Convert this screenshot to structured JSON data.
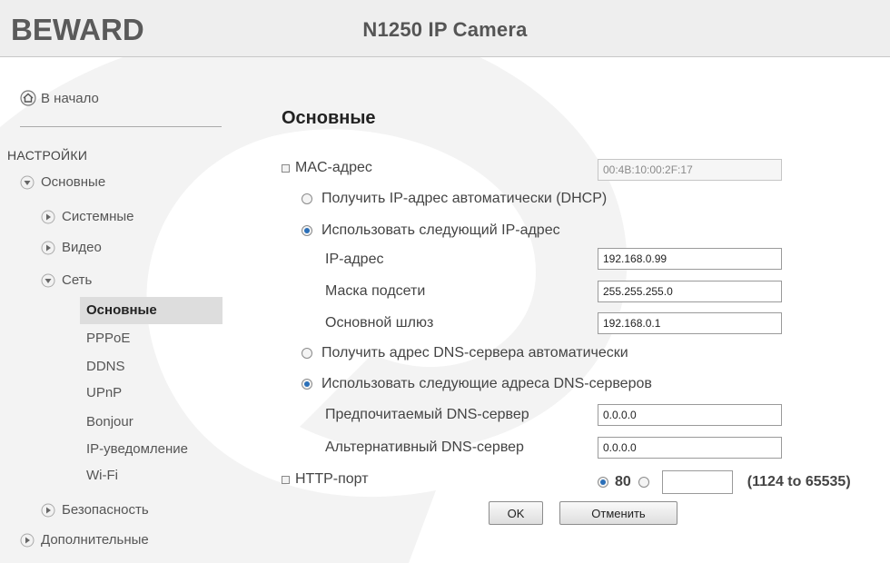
{
  "header": {
    "logo_text": "BEWARD",
    "title": "N1250 IP Camera"
  },
  "sidebar": {
    "home_label": "В начало",
    "home_icon": "home-icon",
    "section_title": "НАСТРОЙКИ",
    "groups": {
      "basic": "Основные",
      "system": "Системные",
      "video": "Видео",
      "network": "Сеть",
      "security": "Безопасность",
      "advanced": "Дополнительные"
    },
    "network_items": [
      "Основные",
      "PPPoE",
      "DDNS",
      "UPnP",
      "Bonjour",
      "IP-уведомление",
      "Wi-Fi"
    ],
    "active_item": "Основные"
  },
  "main": {
    "title": "Основные",
    "mac_label": "MAC-адрес",
    "mac_value": "00:4B:10:00:2F:17",
    "ip_mode": {
      "dhcp_label": "Получить IP-адрес автоматически (DHCP)",
      "static_label": "Использовать следующий IP-адрес",
      "selected": "static"
    },
    "ip_label": "IP-адрес",
    "ip_value": "192.168.0.99",
    "mask_label": "Маска подсети",
    "mask_value": "255.255.255.0",
    "gateway_label": "Основной шлюз",
    "gateway_value": "192.168.0.1",
    "dns_mode": {
      "auto_label": "Получить адрес DNS-сервера автоматически",
      "manual_label": "Использовать следующие адреса DNS-серверов",
      "selected": "manual"
    },
    "dns1_label": "Предпочитаемый DNS-сервер",
    "dns1_value": "0.0.0.0",
    "dns2_label": "Альтернативный DNS-сервер",
    "dns2_value": "0.0.0.0",
    "http_label": "HTTP-порт",
    "http_default": "80",
    "http_custom_value": "",
    "http_range": "(1124 to 65535)",
    "ok_label": "OK",
    "cancel_label": "Отменить"
  },
  "colors": {
    "header_bg": "#eeeeee",
    "active_item_bg": "#dddddd",
    "radio_dot": "#2a6fb8",
    "watermark": "#f2f2f2"
  }
}
